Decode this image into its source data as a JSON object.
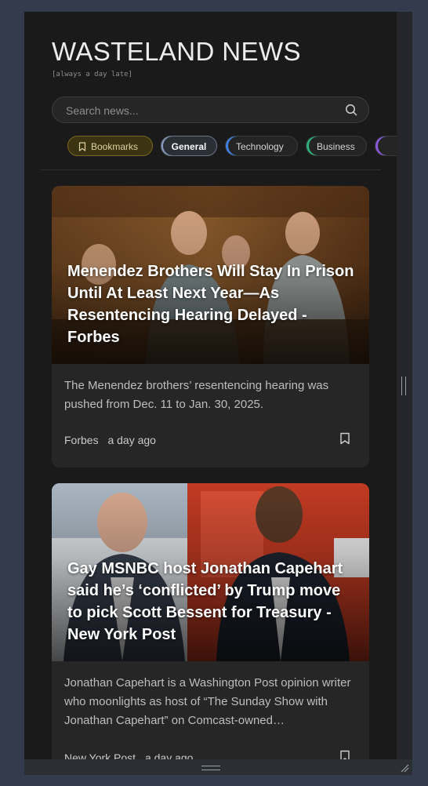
{
  "header": {
    "title": "WASTELAND NEWS",
    "tagline": "[always a day late]"
  },
  "search": {
    "placeholder": "Search news...",
    "icon": "search-icon"
  },
  "categories": [
    {
      "label": "Bookmarks",
      "icon": "bookmark-icon",
      "color": "#7a6620",
      "active": false
    },
    {
      "label": "General",
      "color": "#8aa0c4",
      "active": true
    },
    {
      "label": "Technology",
      "color": "#3f83e8",
      "active": false
    },
    {
      "label": "Business",
      "color": "#2bb37c",
      "active": false
    },
    {
      "label": "",
      "color": "#8a5ae0",
      "active": false
    }
  ],
  "articles": [
    {
      "title": "Menendez Brothers Will Stay In Prison Until At Least Next Year—As Resentencing Hearing Delayed - Forbes",
      "description": "The Menendez brothers’ resentencing hearing was pushed from Dec. 11 to Jan. 30, 2025.",
      "source": "Forbes",
      "time": "a day ago"
    },
    {
      "title": "Gay MSNBC host Jonathan Capehart said he’s ‘conflicted’ by Trump move to pick Scott Bessent for Treasury - New York Post",
      "description": "Jonathan Capehart is a Washington Post opinion writer who moonlights as host of “The Sunday Show with Jonathan Capehart” on Comcast-owned…",
      "source": "New York Post",
      "time": "a day ago"
    }
  ],
  "colors": {
    "page_background": "#333b4d",
    "app_background": "#1a1a1a",
    "card_background": "#262626",
    "text_primary": "#ffffff",
    "text_secondary": "#bdbdbd"
  }
}
